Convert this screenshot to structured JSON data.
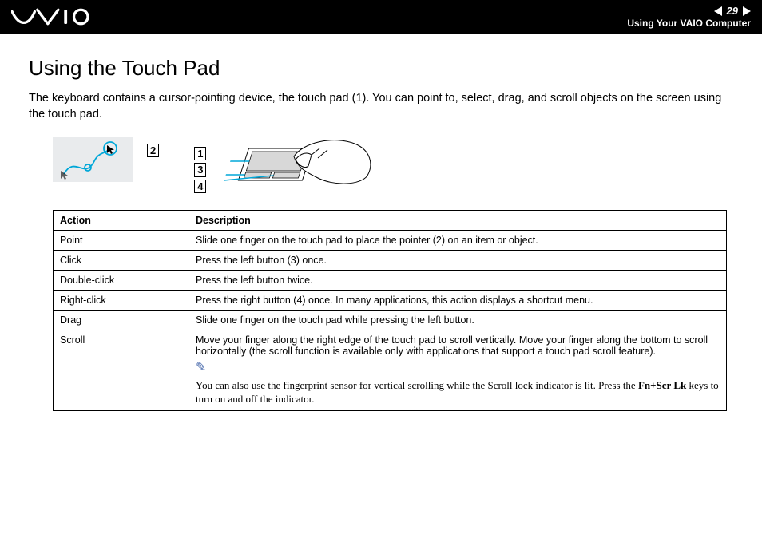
{
  "header": {
    "page_number": "29",
    "breadcrumb": "Using Your VAIO Computer"
  },
  "page": {
    "title": "Using the Touch Pad",
    "intro": "The keyboard contains a cursor-pointing device, the touch pad (1). You can point to, select, drag, and scroll objects on the screen using the touch pad."
  },
  "illustration": {
    "label2": "2",
    "label1": "1",
    "label3": "3",
    "label4": "4"
  },
  "table": {
    "headers": {
      "action": "Action",
      "description": "Description"
    },
    "rows": [
      {
        "action": "Point",
        "description": "Slide one finger on the touch pad to place the pointer (2) on an item or object."
      },
      {
        "action": "Click",
        "description": "Press the left button (3) once."
      },
      {
        "action": "Double-click",
        "description": "Press the left button twice."
      },
      {
        "action": "Right-click",
        "description": "Press the right button (4) once. In many applications, this action displays a shortcut menu."
      },
      {
        "action": "Drag",
        "description": "Slide one finger on the touch pad while pressing the left button."
      },
      {
        "action": "Scroll",
        "description": "Move your finger along the right edge of the touch pad to scroll vertically. Move your finger along the bottom to scroll horizontally (the scroll function is available only with applications that support a touch pad scroll feature)."
      }
    ],
    "note_prefix": "You can also use the fingerprint sensor for vertical scrolling while the Scroll lock indicator is lit. Press the ",
    "note_key": "Fn+Scr Lk",
    "note_suffix": " keys to turn on and off the indicator."
  }
}
